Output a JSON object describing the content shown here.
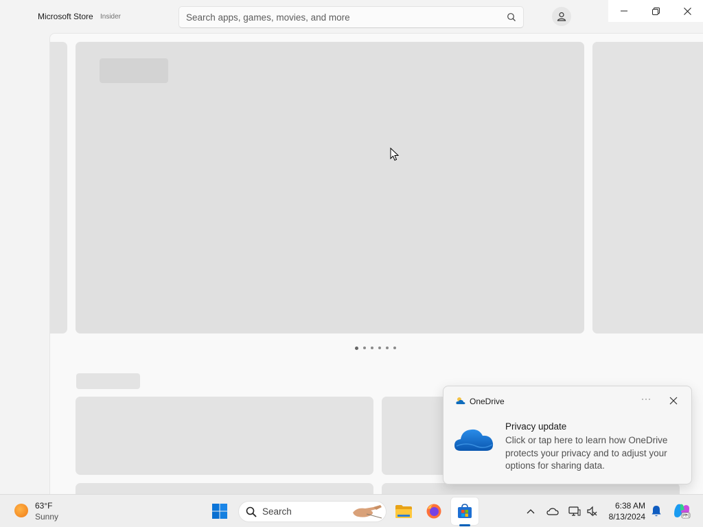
{
  "window": {
    "app_title": "Microsoft Store",
    "app_badge": "Insider",
    "search_placeholder": "Search apps, games, movies, and more"
  },
  "hero": {
    "slide_count": 6,
    "active_slide": 1
  },
  "toast": {
    "app_name": "OneDrive",
    "more_label": "···",
    "title": "Privacy update",
    "body": "Click or tap here to learn how OneDrive protects your privacy and to adjust your options for sharing data."
  },
  "taskbar": {
    "weather": {
      "temperature": "63°F",
      "condition": "Sunny"
    },
    "search_label": "Search",
    "clock": {
      "time": "6:38 AM",
      "date": "8/13/2024"
    },
    "pinned": [
      "windows-start-icon",
      "file-explorer-icon",
      "firefox-icon",
      "microsoft-store-icon"
    ],
    "tray": [
      "chevron-up-icon",
      "onedrive-icon",
      "network-icon",
      "volume-icon",
      "notification-bell-icon",
      "copilot-icon"
    ]
  },
  "colors": {
    "accent": "#005fb8",
    "skeleton": "#e3e3e3",
    "onedrive_blue": "#0f6cbd"
  }
}
